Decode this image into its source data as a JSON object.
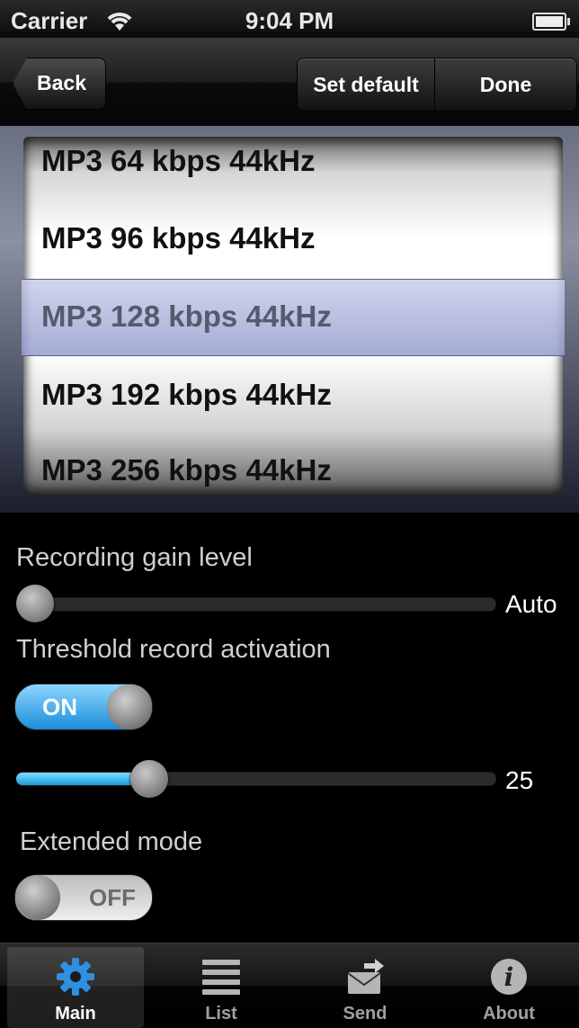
{
  "status_bar": {
    "carrier": "Carrier",
    "time": "9:04 PM"
  },
  "nav": {
    "back_label": "Back",
    "set_default_label": "Set default",
    "done_label": "Done"
  },
  "picker": {
    "options": [
      "MP3 64 kbps 44kHz",
      "MP3 96 kbps 44kHz",
      "MP3 128 kbps 44kHz",
      "MP3 192 kbps 44kHz",
      "MP3 256 kbps 44kHz"
    ],
    "selected": "MP3 128 kbps 44kHz"
  },
  "settings": {
    "gain": {
      "label": "Recording gain level",
      "value": "Auto",
      "level": 0
    },
    "threshold": {
      "label": "Threshold record activation",
      "toggle": "ON",
      "value": "25",
      "level": 0.26
    },
    "extended": {
      "label": "Extended mode",
      "toggle": "OFF"
    }
  },
  "tabbar": {
    "items": [
      {
        "label": "Main",
        "icon": "gear-icon",
        "active": true
      },
      {
        "label": "List",
        "icon": "list-icon",
        "active": false
      },
      {
        "label": "Send",
        "icon": "send-envelope-icon",
        "active": false
      },
      {
        "label": "About",
        "icon": "info-icon",
        "active": false
      }
    ]
  },
  "colors": {
    "accent": "#1b9ad8",
    "background": "#000000"
  }
}
